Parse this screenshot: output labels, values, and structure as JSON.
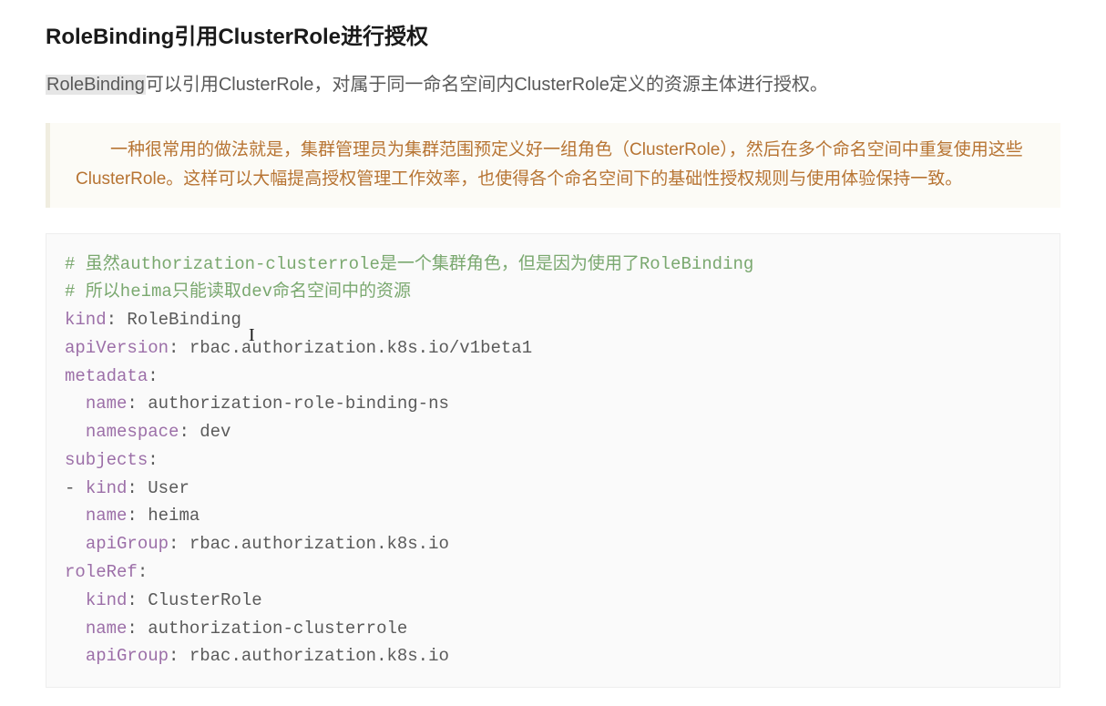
{
  "heading": "RoleBinding引用ClusterRole进行授权",
  "intro": {
    "highlight": "RoleBinding",
    "rest": "可以引用ClusterRole，对属于同一命名空间内ClusterRole定义的资源主体进行授权。"
  },
  "note": "一种很常用的做法就是，集群管理员为集群范围预定义好一组角色（ClusterRole），然后在多个命名空间中重复使用这些ClusterRole。这样可以大幅提高授权管理工作效率，也使得各个命名空间下的基础性授权规则与使用体验保持一致。",
  "code": {
    "comment1": "# 虽然authorization-clusterrole是一个集群角色，但是因为使用了RoleBinding",
    "comment2": "# 所以heima只能读取dev命名空间中的资源",
    "k_kind": "kind",
    "v_kind": "RoleBinding",
    "k_apiVersion": "apiVersion",
    "v_apiVersion": "rbac.authorization.k8s.io/v1beta1",
    "k_metadata": "metadata",
    "k_name": "name",
    "v_md_name": "authorization-role-binding-ns",
    "k_namespace": "namespace",
    "v_namespace": "dev",
    "k_subjects": "subjects",
    "k_subj_kind": "kind",
    "v_subj_kind": "User",
    "v_subj_name": "heima",
    "k_apiGroup": "apiGroup",
    "v_apiGroup": "rbac.authorization.k8s.io",
    "k_roleRef": "roleRef",
    "v_rr_kind": "ClusterRole",
    "v_rr_name": "authorization-clusterrole",
    "v_rr_apiGroup": "rbac.authorization.k8s.io"
  }
}
